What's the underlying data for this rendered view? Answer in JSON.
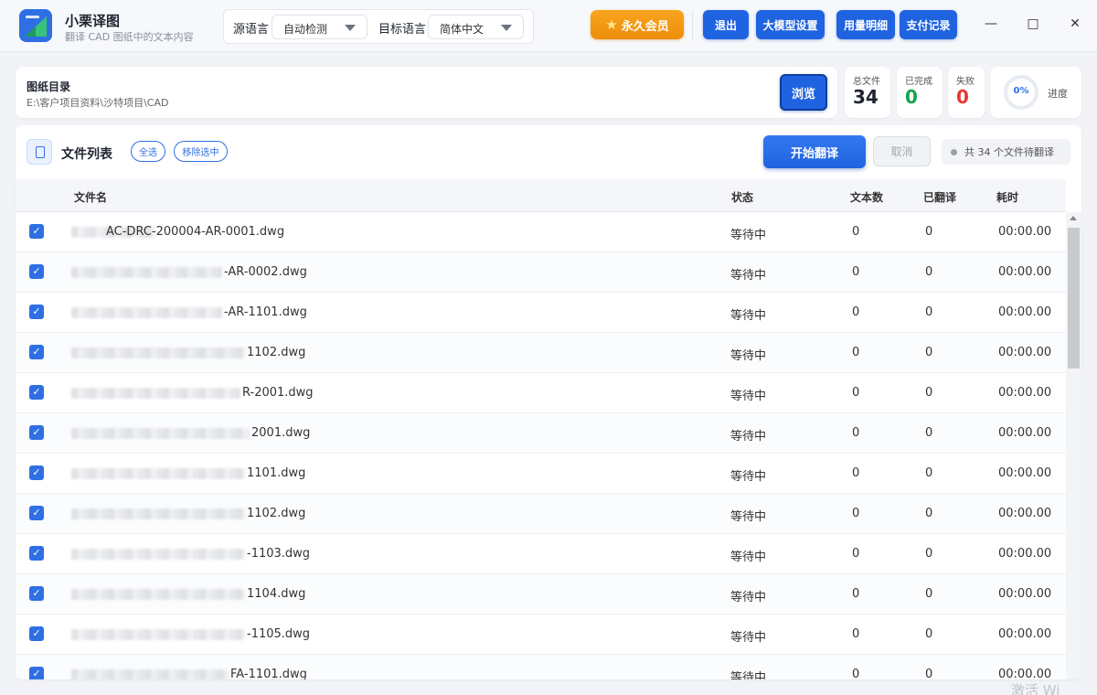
{
  "app": {
    "name": "小栗译图",
    "subtitle": "翻译 CAD 图纸中的文本内容"
  },
  "languages": {
    "source_label": "源语言",
    "source_value": "自动检测",
    "target_label": "目标语言",
    "target_value": "简体中文"
  },
  "header_buttons": {
    "vip": "永久会员",
    "logout": "退出",
    "llm_settings": "大模型设置",
    "usage_detail": "用量明细",
    "payment_record": "支付记录"
  },
  "window_controls": {
    "minimize": "—",
    "maximize": "□",
    "close": "✕"
  },
  "directory": {
    "title": "图纸目录",
    "path": "E:\\客户项目资料\\沙特项目\\CAD",
    "browse": "浏览"
  },
  "stats": {
    "total_label": "总文件",
    "total": "34",
    "done_label": "已完成",
    "done": "0",
    "failed_label": "失败",
    "failed": "0",
    "progress_text": "0%",
    "progress_fraction": 0,
    "progress_label": "进度"
  },
  "file_list": {
    "title": "文件列表",
    "select_all": "全选",
    "remove_selected": "移除选中",
    "start": "开始翻译",
    "cancel": "取消",
    "pending_text": "共 34 个文件待翻译",
    "columns": {
      "name": "文件名",
      "status": "状态",
      "text_count": "文本数",
      "translated": "已翻译",
      "elapsed": "耗时"
    },
    "rows": [
      {
        "name": "AC-DRC-200004-AR-0001.dwg",
        "status": "等待中",
        "text_count": "0",
        "translated": "0",
        "elapsed": "00:00.00"
      },
      {
        "name": "-AR-0002.dwg",
        "status": "等待中",
        "text_count": "0",
        "translated": "0",
        "elapsed": "00:00.00"
      },
      {
        "name": "-AR-1101.dwg",
        "status": "等待中",
        "text_count": "0",
        "translated": "0",
        "elapsed": "00:00.00"
      },
      {
        "name": "1102.dwg",
        "status": "等待中",
        "text_count": "0",
        "translated": "0",
        "elapsed": "00:00.00"
      },
      {
        "name": "R-2001.dwg",
        "status": "等待中",
        "text_count": "0",
        "translated": "0",
        "elapsed": "00:00.00"
      },
      {
        "name": "2001.dwg",
        "status": "等待中",
        "text_count": "0",
        "translated": "0",
        "elapsed": "00:00.00"
      },
      {
        "name": "1101.dwg",
        "status": "等待中",
        "text_count": "0",
        "translated": "0",
        "elapsed": "00:00.00"
      },
      {
        "name": "1102.dwg",
        "status": "等待中",
        "text_count": "0",
        "translated": "0",
        "elapsed": "00:00.00"
      },
      {
        "name": "-1103.dwg",
        "status": "等待中",
        "text_count": "0",
        "translated": "0",
        "elapsed": "00:00.00"
      },
      {
        "name": "1104.dwg",
        "status": "等待中",
        "text_count": "0",
        "translated": "0",
        "elapsed": "00:00.00"
      },
      {
        "name": "-1105.dwg",
        "status": "等待中",
        "text_count": "0",
        "translated": "0",
        "elapsed": "00:00.00"
      },
      {
        "name": "FA-1101.dwg",
        "status": "等待中",
        "text_count": "0",
        "translated": "0",
        "elapsed": "00:00.00"
      }
    ]
  },
  "watermark": "激活 Wi",
  "colors": {
    "primary": "#1f63e0",
    "vip": "#f39a15",
    "done": "#16a34a",
    "failed": "#e53935"
  }
}
